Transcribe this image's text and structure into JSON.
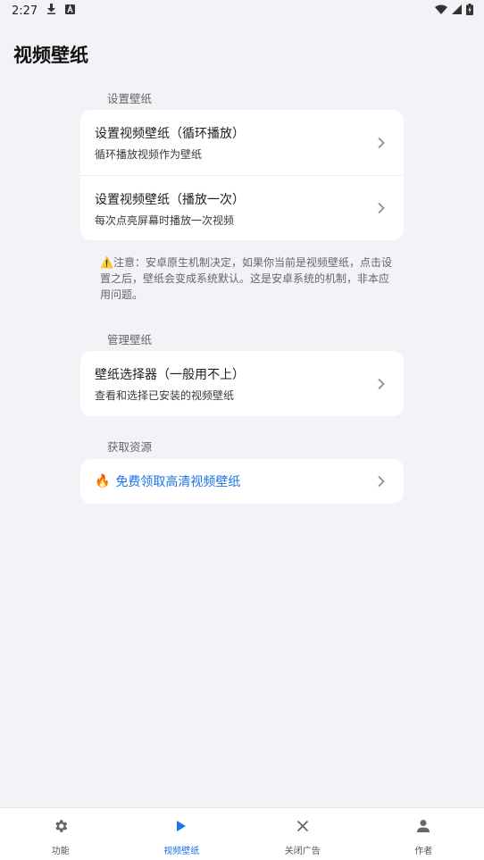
{
  "status_bar": {
    "time": "2:27",
    "icons": [
      "download-icon",
      "a-badge-icon",
      "wifi-icon",
      "signal-icon",
      "battery-charging-icon"
    ]
  },
  "page": {
    "title": "视频壁纸"
  },
  "sections": {
    "set": {
      "header": "设置壁纸",
      "items": [
        {
          "title": "设置视频壁纸（循环播放）",
          "subtitle": "循环播放视频作为壁纸"
        },
        {
          "title": "设置视频壁纸（播放一次）",
          "subtitle": "每次点亮屏幕时播放一次视频"
        }
      ]
    },
    "note": {
      "icon": "warning-icon",
      "text": "⚠️注意：安卓原生机制决定，如果你当前是视频壁纸，点击设置之后，壁纸会变成系统默认。这是安卓系统的机制，非本应用问题。"
    },
    "manage": {
      "header": "管理壁纸",
      "items": [
        {
          "title": "壁纸选择器（一般用不上）",
          "subtitle": "查看和选择已安装的视频壁纸"
        }
      ]
    },
    "resources": {
      "header": "获取资源",
      "link": {
        "emoji": "🔥",
        "label": "免费领取高清视频壁纸"
      }
    }
  },
  "bottom_nav": {
    "items": [
      {
        "label": "功能",
        "icon": "gear-icon",
        "active": false
      },
      {
        "label": "视频壁纸",
        "icon": "play-icon",
        "active": true
      },
      {
        "label": "关闭广告",
        "icon": "close-icon",
        "active": false
      },
      {
        "label": "作者",
        "icon": "person-icon",
        "active": false
      }
    ]
  },
  "colors": {
    "accent": "#1a73e8",
    "background": "#f3f2f7",
    "card": "#ffffff"
  }
}
